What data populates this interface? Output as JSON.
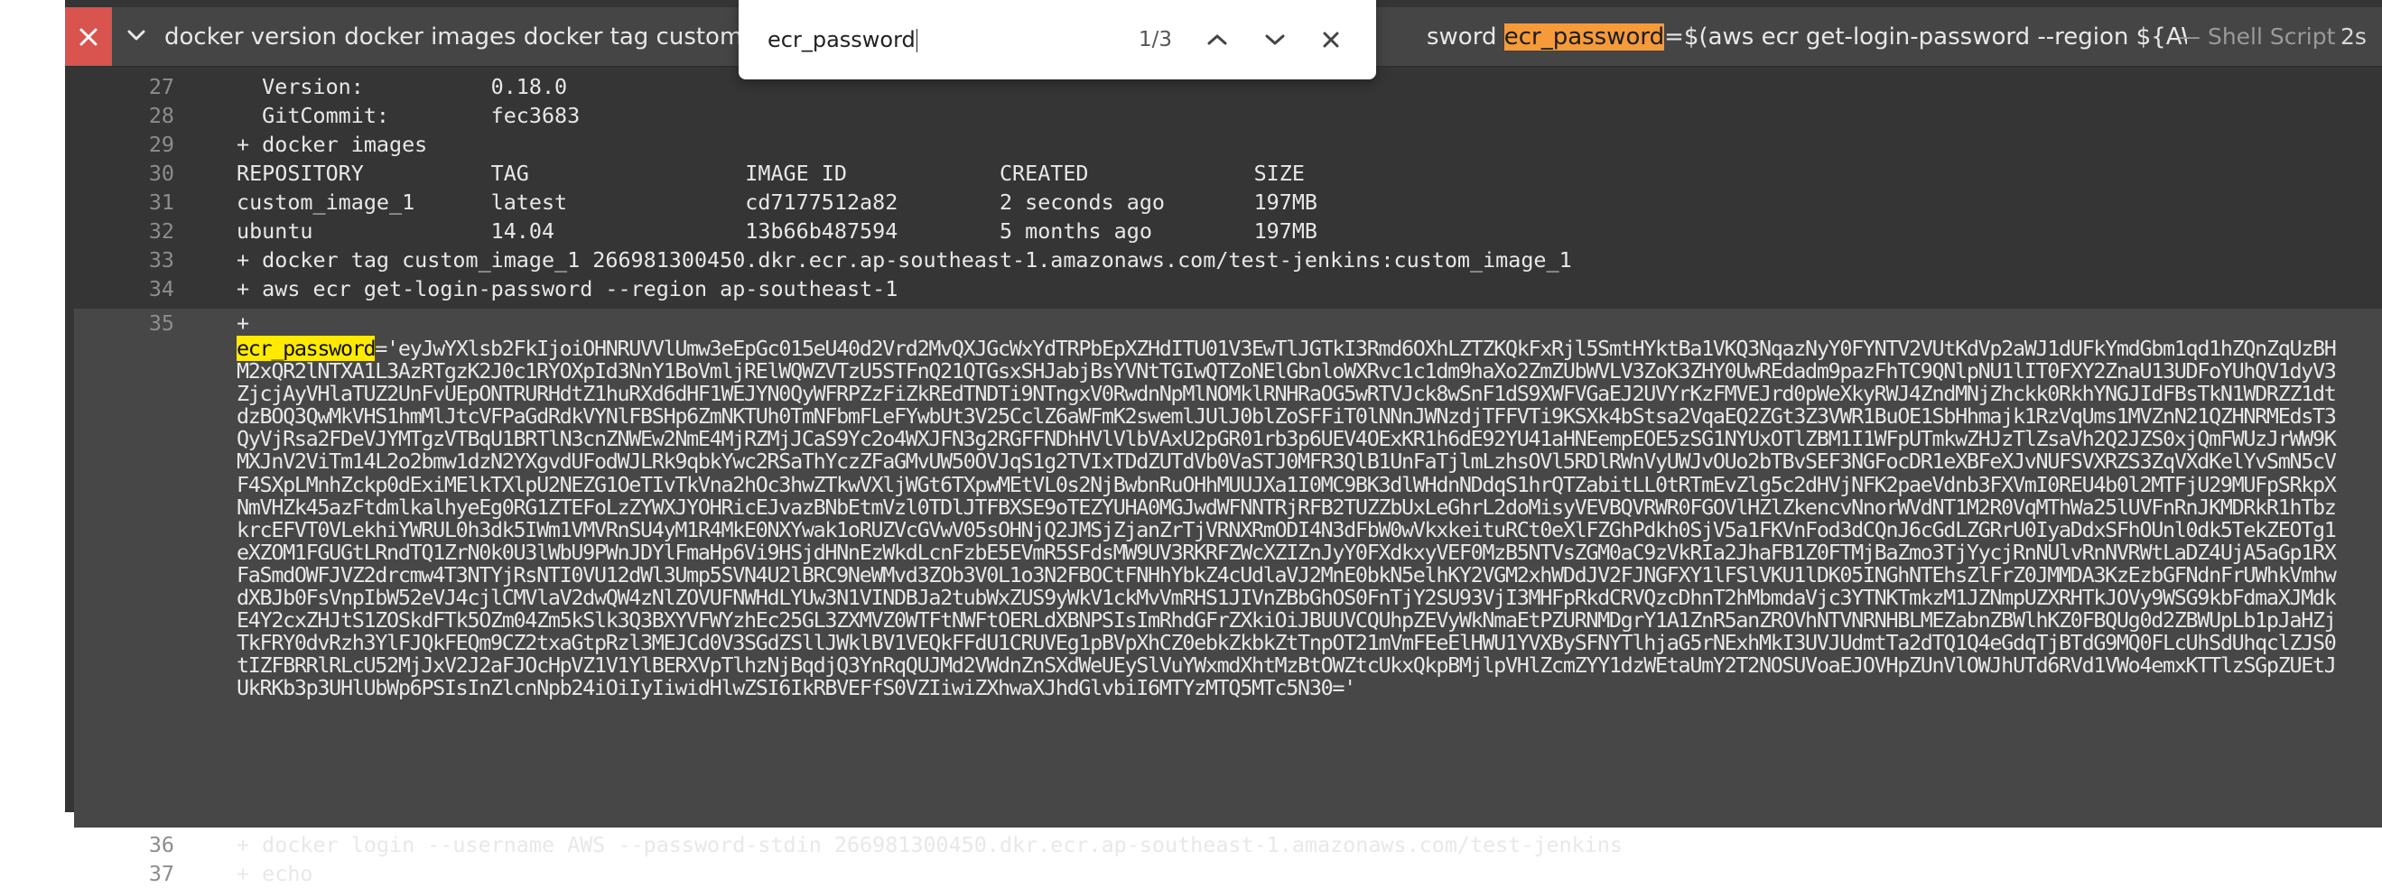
{
  "step": {
    "status": "failed",
    "command_left": "docker version docker images docker tag custom_im",
    "command_right_prefix": "sword ",
    "command_right_match": "ecr_password",
    "command_right_suffix": "=$(aws ecr get-login-password --region ${AWS_...",
    "type_label": "— Shell Script",
    "duration": "2s"
  },
  "find": {
    "query": "ecr_password",
    "count": "1/3",
    "icons": [
      "chevron-up-icon",
      "chevron-down-icon",
      "close-icon"
    ]
  },
  "colors": {
    "panel": "#353535",
    "status_fail": "#d9534f",
    "current_match": "#f59b3a",
    "match": "#ffea00"
  },
  "log": {
    "lines": [
      {
        "num": "27",
        "text": "  Version:          0.18.0"
      },
      {
        "num": "28",
        "text": "  GitCommit:        fec3683"
      },
      {
        "num": "29",
        "text": "+ docker images"
      },
      {
        "num": "30",
        "text": "REPOSITORY          TAG                 IMAGE ID            CREATED             SIZE"
      },
      {
        "num": "31",
        "text": "custom_image_1      latest              cd7177512a82        2 seconds ago       197MB"
      },
      {
        "num": "32",
        "text": "ubuntu              14.04               13b66b487594        5 months ago        197MB"
      },
      {
        "num": "33",
        "text": "+ docker tag custom_image_1 266981300450.dkr.ecr.ap-southeast-1.amazonaws.com/test-jenkins:custom_image_1"
      },
      {
        "num": "34",
        "text": "+ aws ecr get-login-password --region ap-southeast-1"
      }
    ],
    "line35": {
      "num": "35",
      "text": "+",
      "var": "ecr_password",
      "value": "='eyJwYXlsb2FkIjoiOHNRUVVlUmw3eEpGc015eU40d2Vrd2MvQXJGcWxYdTRPbEpXZHdITU01V3EwTlJGTkI3Rmd6OXhLZTZKQkFxRjl5SmtHYktBa1VKQ3NqazNyY0FYNTV2VUtKdVp2aWJ1dUFkYmdGbm1qd1hZQnZqUzBHM2xQR2lNTXA1L3AzRTgzK2J0c1RYOXpId3NnY1BoVmljRElWQWZVTzU5STFnQ21QTGsxSHJabjBsYVNtTGIwQTZoNElGbnloWXRvc1c1dm9haXo2ZmZUbWVLV3ZoK3ZHY0UwREdadm9pazFhTC9QNlpNU1lIT0FXY2ZnaU13UDFoYUhQV1dyV3ZjcjAyVHlaTUZ2UnFvUEpONTRURHdtZ1huRXd6dHF1WEJYN0QyWFRPZzFiZkREdTNDTi9NTngxV0RwdnNpMlNOMklRNHRaOG5wRTVJck8wSnF1dS9XWFVGaEJ2UVYrKzFMVEJrd0pWeXkyRWJ4ZndMNjZhckk0RkhYNGJIdFBsTkN1WDRZZ1dtdzBOQ3QwMkVHS1hmMlJtcVFPaGdRdkVYNlFBSHp6ZmNKTUh0TmNFbmFLeFYwbUt3V25CclZ6aWFmK2swemlJUlJ0blZoSFFiT0lNNnJWNzdjTFFVTi9KSXk4bStsa2VqaEQ2ZGt3Z3VWR1BuOE1SbHhmajk1RzVqUms1MVZnN21QZHNRMEdsT3QyVjRsa2FDeVJYMTgzVTBqU1BRTlN3cnZNWEw2NmE4MjRZMjJCaS9Yc2o4WXJFN3g2RGFFNDhHVlVlbVAxU2pGR01rb3p6UEV4OExKR1h6dE92YU41aHNEempEOE5zSG1NYUxOTlZBM1I1WFpUTmkwZHJzTlZsaVh2Q2JZS0xjQmFWUzJrWW9KMXJnV2ViTm14L2o2bmw1dzN2YXgvdUFodWJLRk9qbkYwc2RSaThYczZFaGMvUW50OVJqS1g2TVIxTDdZUTdVb0VaSTJ0MFR3QlB1UnFaTjlmLzhsOVl5RDlRWnVyUWJvOUo2bTBvSEF3NGFocDR1eXBFeXJvNUFSVXRZS3ZqVXdKelYvSmN5cVF4SXpLMnhZckp0dExiMElkTXlpU2NEZG1OeTIvTkVna2hOc3hwZTkwVXljWGt6TXpwMEtVL0s2NjBwbnRuOHhMUUJXa1I0MC9BK3dlWHdnNDdqS1hrQTZabitLL0tRTmEvZlg5c2dHVjNFK2paeVdnb3FXVmI0REU4b0l2MTFjU29MUFpSRkpXNmVHZk45azFtdmlkalhyeEg0RG1ZTEFoLzZYWXJYOHRicEJvazBNbEtmVzl0TDlJTFBXSE9oTEZYUHA0MGJwdWFNNTRjRFB2TUZZbUxLeGhrL2doMisyVEVBQVRWR0FGOVlHZlZkencvNnorWVdNT1M2R0VqMThWa25lUVFnRnJKMDRkR1hTbzkrcEFVT0VLekhiYWRUL0h3dk5IWm1VMVRnSU4yM1R4MkE0NXYwak1oRUZVcGVwV05sOHNjQ2JMSjZjanZrTjVRNXRmODI4N3dFbW0wVkxkeituRCt0eXlFZGhPdkh0SjV5a1FKVnFod3dCQnJ6cGdLZGRrU0IyaDdxSFhOUnl0dk5TekZEOTg1eXZOM1FGUGtLRndTQ1ZrN0k0U3lWbU9PWnJDYlFmaHp6Vi9HSjdHNnEzWkdLcnFzbE5EVmR5SFdsMW9UV3RKRFZWcXZIZnJyY0FXdkxyVEF0MzB5NTVsZGM0aC9zVkRIa2JhaFB1Z0FTMjBaZmo3TjYycjRnNUlvRnNVRWtLaDZ4UjA5aGp1RXFaSmdOWFJVZ2drcmw4T3NTYjRsNTI0VU12dWl3Ump5SVN4U2lBRC9NeWMvd3ZOb3V0L1o3N2FBOCtFNHhYbkZ4cUdlaVJ2MnE0bkN5elhKY2VGM2xhWDdJV2FJNGFXY1lFSlVKU1lDK05INGhNTEhsZlFrZ0JMMDA3KzEzbGFNdnFrUWhkVmhwdXBJb0FsVnpIbW52eVJ4cjlCMVlaV2dwQW4zNlZOVUFNWHdLYUw3N1VINDBJa2tubWxZUS9yWkV1ckMvVmRHS1JIVnZBbGhOS0FnTjY2SU93VjI3MHFpRkdCRVQzcDhnT2hMbmdaVjc3YTNKTmkzM1JZNmpUZXRHTkJOVy9WSG9kbFdmaXJMdkE4Y2cxZHJtS1ZOSkdFTk5OZm04Zm5kSlk3Q3BXYVFWYzhEc25GL3ZXMVZ0WTFtNWFtOERLdXBNPSIsImRhdGFrZXkiOiJBUUVCQUhpZEVyWkNmaEtPZURNMDgrY1A1ZnR5anZROVhNTVNRNHBLMEZabnZBWlhKZ0FBQUg0d2ZBWUpLb1pJaHZjTkFRY0dvRzh3YlFJQkFEQm9CZ2txaGtpRzl3MEJCd0V3SGdZSllJWklBV1VEQkFFdU1CRUVEg1pBVpXhCZ0ebkZkbkZtTnpOT21mVmFEeElHWU1YVXBySFNYTlhjaG5rNExhMkI3UVJUdmtTa2dTQ1Q4eGdqTjBTdG9MQ0FLcUhSdUhqclZJS0tIZFBRRlRLcU52MjJxV2J2aFJOcHpVZ1V1YlBERXVpTlhzNjBqdjQ3YnRqQUJMd2VWdnZnSXdWeUEySlVuYWxmdXhtMzBtOWZtcUkxQkpBMjlpVHlZcmZYY1dzWEtaUmY2T2NOSUVoaEJOVHpZUnVlOWJhUTd6RVd1VWo4emxKTTlzSGpZUEtJUkRKb3p3UHlUbWp6PSIsInZlcnNpb24iOiIyIiwidHlwZSI6IkRBVEFfS0VZIiwiZXhwaXJhdGlvbiI6MTYzMTQ5MTc5N30='"
    },
    "tail": [
      {
        "num": "36",
        "text": "+ docker login --username AWS --password-stdin 266981300450.dkr.ecr.ap-southeast-1.amazonaws.com/test-jenkins"
      },
      {
        "num": "37",
        "text": "+ echo"
      }
    ]
  }
}
